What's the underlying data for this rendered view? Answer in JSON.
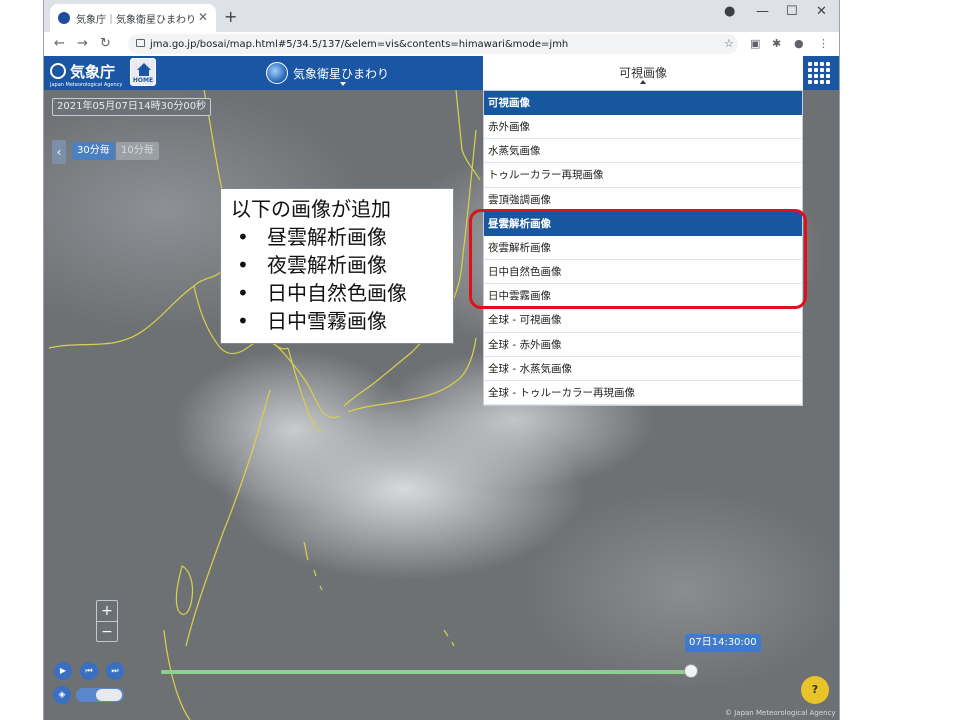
{
  "browser": {
    "tab_title": "気象庁｜気象衛星ひまわり",
    "url": "jma.go.jp/bosai/map.html#5/34.5/137/&elem=vis&contents=himawari&mode=jmh",
    "icons": [
      "back-icon",
      "forward-icon",
      "reload-icon",
      "lock-icon",
      "star-icon",
      "extension-icon",
      "profile-icon",
      "menu-icon"
    ]
  },
  "header": {
    "logo_text": "気象庁",
    "logo_sub": "Japan Meteorological Agency",
    "home_label": "HOME",
    "satellite_label": "気象衛星ひまわり",
    "image_type_label": "可視画像"
  },
  "map": {
    "datetime": "2021年05月07日14時30分00秒",
    "interval_30": "30分毎",
    "interval_10": "10分毎",
    "current_time": "07日14:30:00",
    "copyright": "© Japan Meteorological Agency",
    "zoom_in": "+",
    "zoom_out": "−"
  },
  "dropdown": {
    "sections": [
      {
        "header": "可視画像",
        "items": [
          "赤外画像",
          "水蒸気画像",
          "トゥルーカラー再現画像",
          "雲頂強調画像"
        ]
      },
      {
        "header": "昼雲解析画像",
        "items": [
          "夜雲解析画像",
          "日中自然色画像",
          "日中雲霧画像",
          "全球 - 可視画像",
          "全球 - 赤外画像",
          "全球 - 水蒸気画像",
          "全球 - トゥルーカラー再現画像"
        ]
      }
    ]
  },
  "callout": {
    "title": "以下の画像が追加",
    "items": [
      "昼雲解析画像",
      "夜雲解析画像",
      "日中自然色画像",
      "日中雪霧画像"
    ]
  },
  "colors": {
    "header_blue": "#1a56a4",
    "highlight_red": "#e0101a",
    "timeline_green": "#8ed08e"
  }
}
